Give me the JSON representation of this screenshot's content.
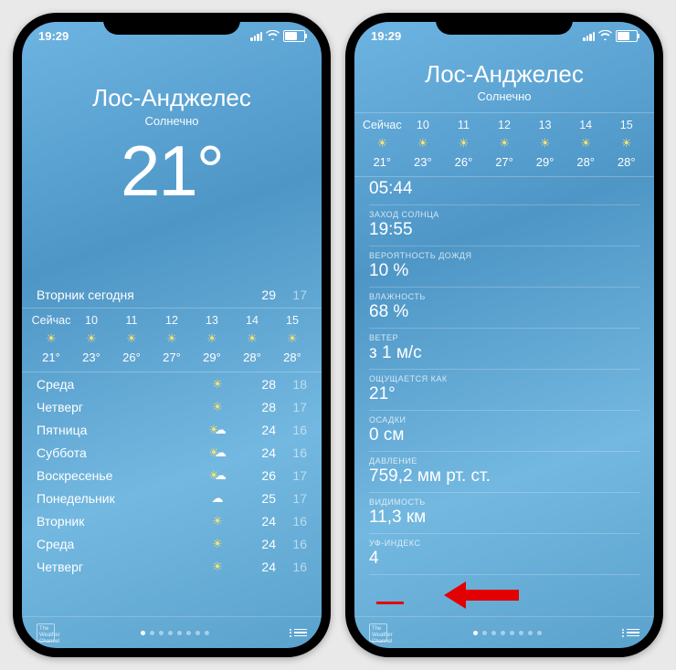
{
  "status": {
    "time": "19:29"
  },
  "left": {
    "city": "Лос-Анджелес",
    "condition": "Солнечно",
    "temp": "21°",
    "today_label": "Вторник сегодня",
    "today_hi": "29",
    "today_lo": "17",
    "hours": [
      {
        "h": "Сейчас",
        "t": "21°"
      },
      {
        "h": "10",
        "t": "23°"
      },
      {
        "h": "11",
        "t": "26°"
      },
      {
        "h": "12",
        "t": "27°"
      },
      {
        "h": "13",
        "t": "29°"
      },
      {
        "h": "14",
        "t": "28°"
      },
      {
        "h": "15",
        "t": "28°"
      }
    ],
    "days": [
      {
        "d": "Среда",
        "ic": "sun",
        "hi": "28",
        "lo": "18"
      },
      {
        "d": "Четверг",
        "ic": "sun",
        "hi": "28",
        "lo": "17"
      },
      {
        "d": "Пятница",
        "ic": "pc",
        "hi": "24",
        "lo": "16"
      },
      {
        "d": "Суббота",
        "ic": "pc",
        "hi": "24",
        "lo": "16"
      },
      {
        "d": "Воскресенье",
        "ic": "pc",
        "hi": "26",
        "lo": "17"
      },
      {
        "d": "Понедельник",
        "ic": "cl",
        "hi": "25",
        "lo": "17"
      },
      {
        "d": "Вторник",
        "ic": "sun",
        "hi": "24",
        "lo": "16"
      },
      {
        "d": "Среда",
        "ic": "sun",
        "hi": "24",
        "lo": "16"
      },
      {
        "d": "Четверг",
        "ic": "sun",
        "hi": "24",
        "lo": "16"
      }
    ]
  },
  "right": {
    "city": "Лос-Анджелес",
    "condition": "Солнечно",
    "hours": [
      {
        "h": "Сейчас",
        "t": "21°"
      },
      {
        "h": "10",
        "t": "23°"
      },
      {
        "h": "11",
        "t": "26°"
      },
      {
        "h": "12",
        "t": "27°"
      },
      {
        "h": "13",
        "t": "29°"
      },
      {
        "h": "14",
        "t": "28°"
      },
      {
        "h": "15",
        "t": "28°"
      }
    ],
    "sunrise": "05:44",
    "details": [
      {
        "k": "ЗАХОД СОЛНЦА",
        "v": "19:55"
      },
      {
        "k": "ВЕРОЯТНОСТЬ ДОЖДЯ",
        "v": "10 %"
      },
      {
        "k": "ВЛАЖНОСТЬ",
        "v": "68 %"
      },
      {
        "k": "ВЕТЕР",
        "v": "з 1 м/с"
      },
      {
        "k": "ОЩУЩАЕТСЯ КАК",
        "v": "21°"
      },
      {
        "k": "ОСАДКИ",
        "v": "0 см"
      },
      {
        "k": "ДАВЛЕНИЕ",
        "v": "759,2 мм рт. ст."
      },
      {
        "k": "ВИДИМОСТЬ",
        "v": "11,3 км"
      },
      {
        "k": "УФ-ИНДЕКС",
        "v": "4"
      }
    ]
  }
}
